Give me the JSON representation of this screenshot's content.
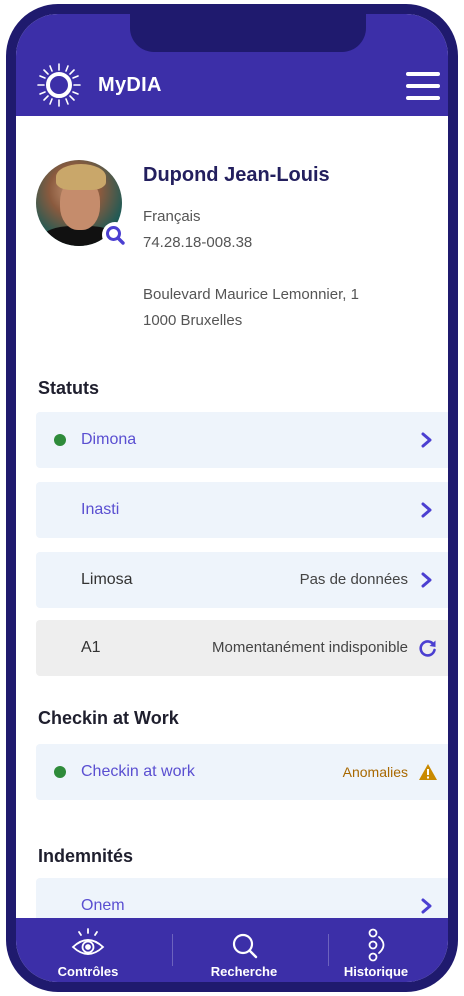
{
  "app": {
    "title": "MyDIA"
  },
  "profile": {
    "name": "Dupond Jean-Louis",
    "nationality": "Français",
    "national_number": "74.28.18-008.38",
    "address_line1": "Boulevard Maurice Lemonnier, 1",
    "address_line2": "1000 Bruxelles"
  },
  "sections": {
    "statuts": "Statuts",
    "checkin": "Checkin at Work",
    "indemnites": "Indemnités"
  },
  "rows": {
    "dimona": {
      "label": "Dimona"
    },
    "inasti": {
      "label": "Inasti"
    },
    "limosa": {
      "label": "Limosa",
      "status": "Pas de données"
    },
    "a1": {
      "label": "A1",
      "status": "Momentanément indisponible"
    },
    "checkin": {
      "label": "Checkin at work",
      "status": "Anomalies"
    },
    "onem": {
      "label": "Onem"
    }
  },
  "nav": {
    "controles": "Contrôles",
    "recherche": "Recherche",
    "historique": "Historique"
  },
  "colors": {
    "brand": "#3c2fa8",
    "link": "#5a4fd1",
    "ok_dot": "#2e8b3a",
    "warning": "#c98a00"
  },
  "icons": [
    "logo-icon",
    "menu-icon",
    "search-icon",
    "chevron-right-icon",
    "refresh-icon",
    "warning-icon",
    "eye-icon",
    "history-icon"
  ]
}
